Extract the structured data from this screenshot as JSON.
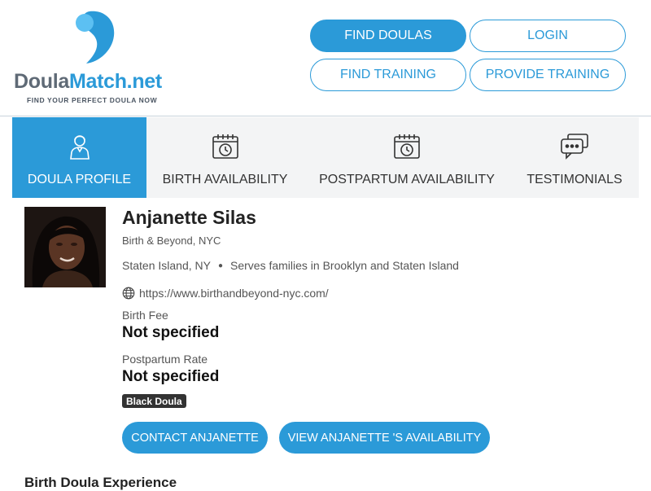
{
  "brand": {
    "name_part1": "Doula",
    "name_part2": "Match.net",
    "tagline": "FIND YOUR PERFECT DOULA NOW",
    "colors": {
      "accent": "#2b9ad8",
      "light_accent": "#5cc0f2",
      "gray": "#5f6a76"
    }
  },
  "header_nav": {
    "find_doulas": "FIND DOULAS",
    "login": "LOGIN",
    "find_training": "FIND TRAINING",
    "provide_training": "PROVIDE TRAINING"
  },
  "tabs": [
    {
      "label": "DOULA PROFILE",
      "icon": "person-icon",
      "active": true
    },
    {
      "label": "BIRTH AVAILABILITY",
      "icon": "calendar-clock-icon",
      "active": false
    },
    {
      "label": "POSTPARTUM AVAILABILITY",
      "icon": "calendar-clock-icon",
      "active": false
    },
    {
      "label": "TESTIMONIALS",
      "icon": "chat-bubbles-icon",
      "active": false
    }
  ],
  "profile": {
    "name": "Anjanette Silas",
    "agency": "Birth & Beyond, NYC",
    "location": "Staten Island, NY",
    "serves": "Serves families in Brooklyn and Staten Island",
    "website": "https://www.birthandbeyond-nyc.com/",
    "website_icon": "globe-icon",
    "birth_fee_label": "Birth Fee",
    "birth_fee_value": "Not specified",
    "postpartum_rate_label": "Postpartum Rate",
    "postpartum_rate_value": "Not specified",
    "badge": "Black Doula",
    "contact_button": "CONTACT ANJANETTE",
    "availability_button": "VIEW ANJANETTE 'S AVAILABILITY"
  },
  "sections": {
    "experience_heading": "Birth Doula Experience"
  }
}
